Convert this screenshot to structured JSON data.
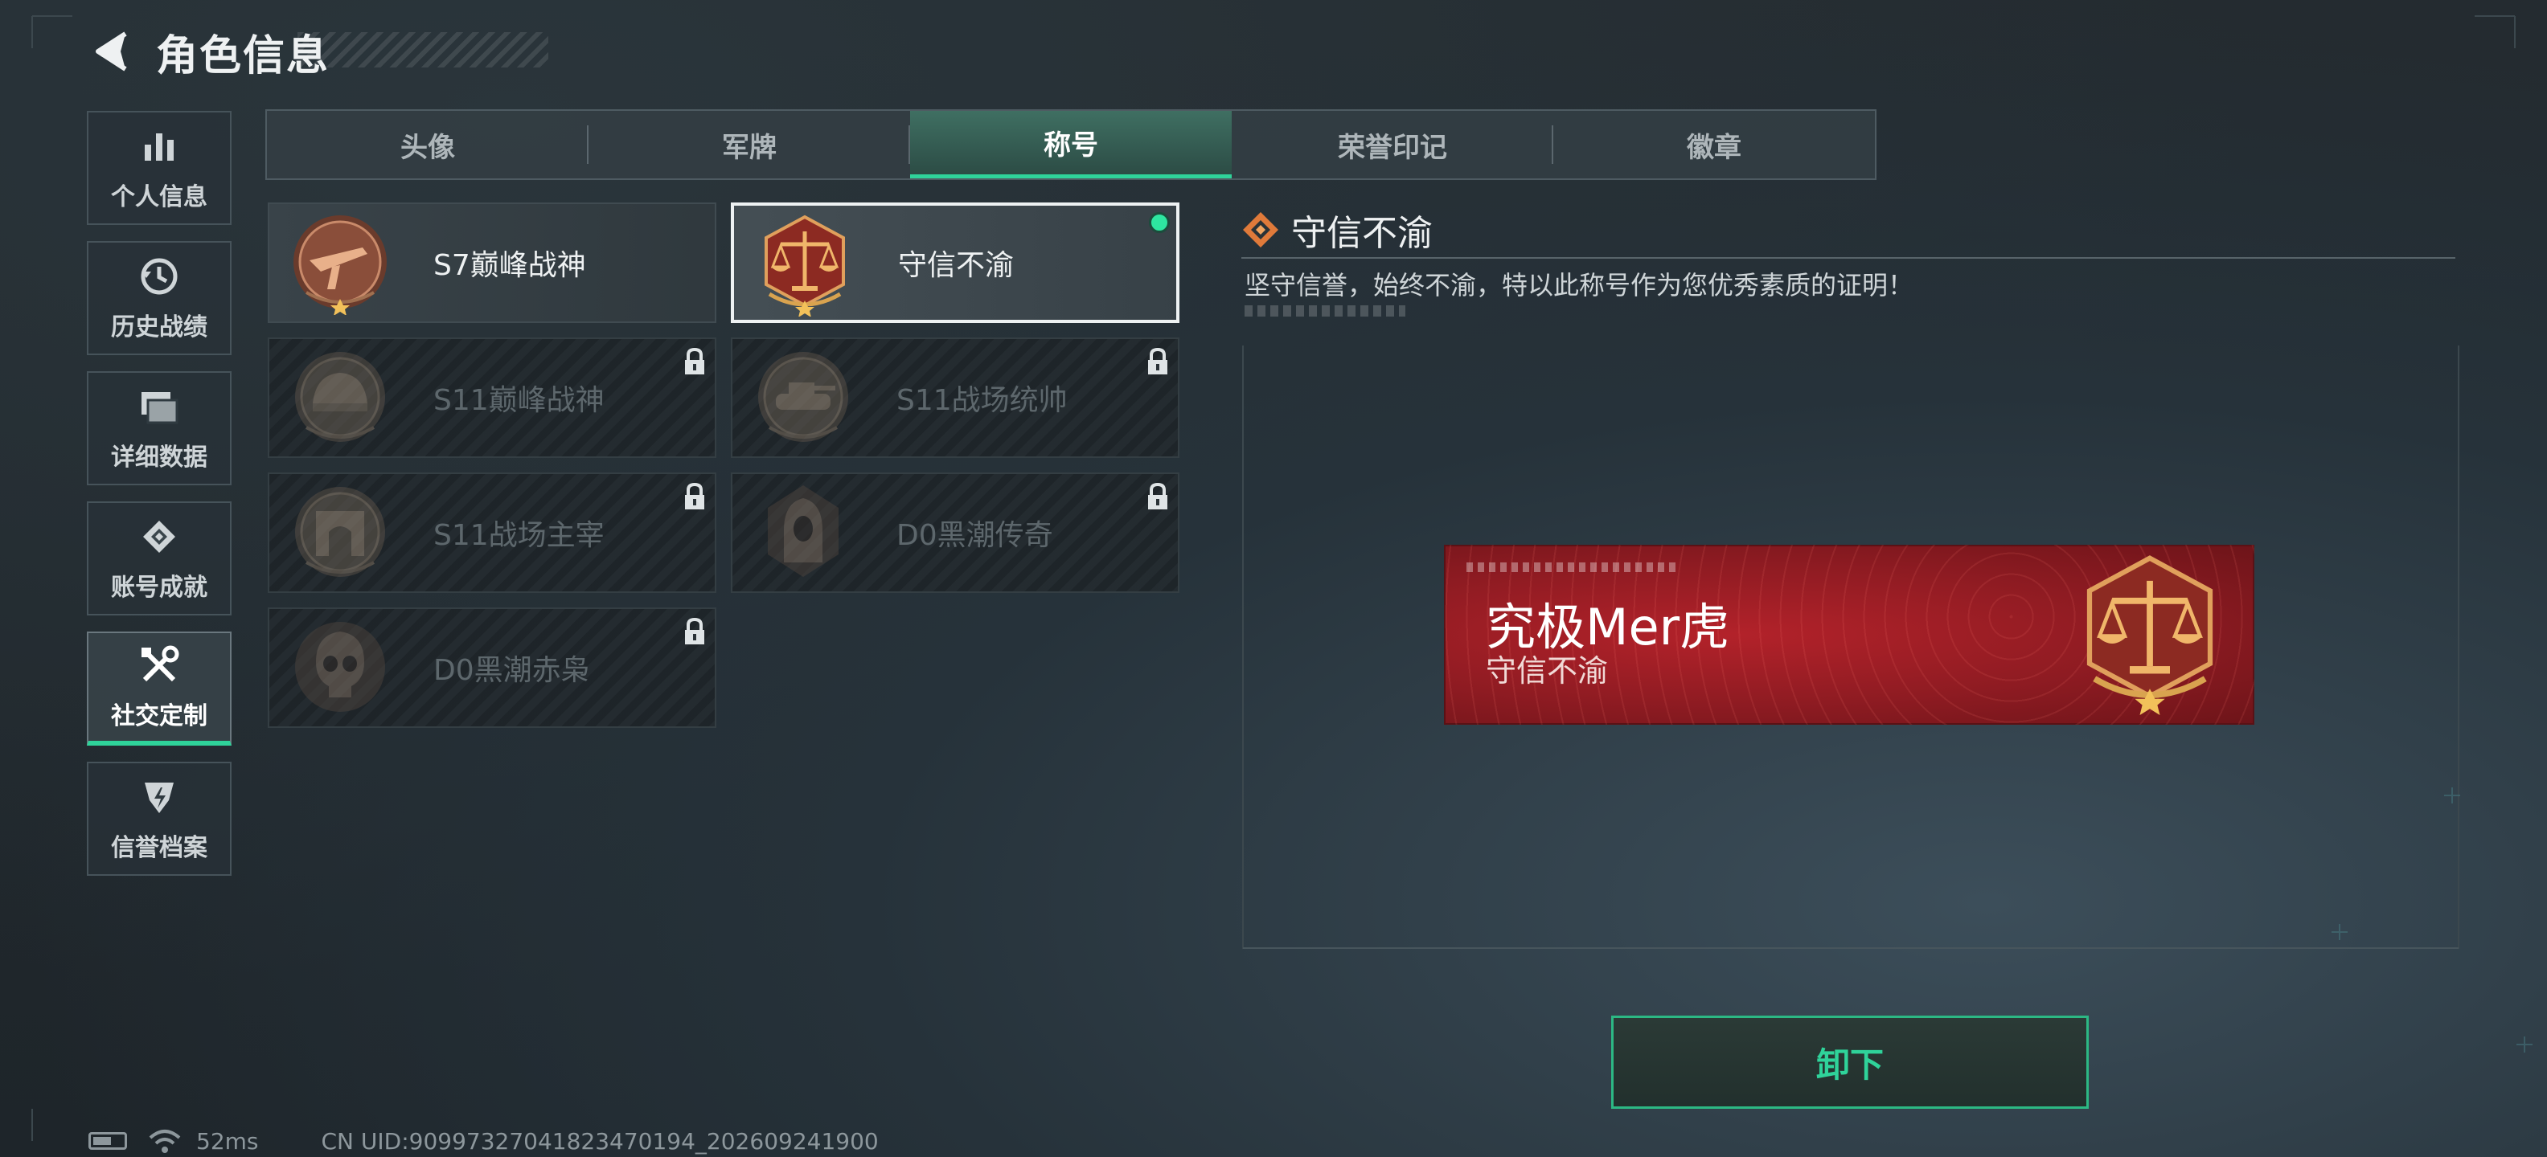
{
  "header": {
    "title": "角色信息"
  },
  "sidebar": {
    "items": [
      {
        "label": "个人信息",
        "icon": "bar-chart-icon"
      },
      {
        "label": "历史战绩",
        "icon": "history-clock-icon"
      },
      {
        "label": "详细数据",
        "icon": "folders-icon"
      },
      {
        "label": "账号成就",
        "icon": "achievement-icon"
      },
      {
        "label": "社交定制",
        "icon": "tools-icon",
        "active": true
      },
      {
        "label": "信誉档案",
        "icon": "credit-shield-icon"
      }
    ]
  },
  "tabs": [
    {
      "label": "头像"
    },
    {
      "label": "军牌"
    },
    {
      "label": "称号",
      "active": true
    },
    {
      "label": "荣誉印记"
    },
    {
      "label": "徽章"
    }
  ],
  "titles": [
    {
      "name": "S7巅峰战神",
      "medal": "rifle-medal-icon",
      "locked": false,
      "selected": false
    },
    {
      "name": "守信不渝",
      "medal": "scales-medal-icon",
      "locked": false,
      "selected": true
    },
    {
      "name": "S11巅峰战神",
      "medal": "helmet-medal-icon",
      "locked": true
    },
    {
      "name": "S11战场统帅",
      "medal": "tank-medal-icon",
      "locked": true
    },
    {
      "name": "S11战场主宰",
      "medal": "arch-medal-icon",
      "locked": true
    },
    {
      "name": "D0黑潮传奇",
      "medal": "hooded-figure-medal-icon",
      "locked": true
    },
    {
      "name": "D0黑潮赤枭",
      "medal": "skull-medal-icon",
      "locked": true
    }
  ],
  "detail": {
    "title": "守信不渝",
    "description": "坚守信誉，始终不渝，特以此称号作为您优秀素质的证明！"
  },
  "banner": {
    "player_name": "究极Mer虎",
    "title": "守信不渝",
    "color": "#a51f27"
  },
  "actions": {
    "unequip_label": "卸下"
  },
  "status": {
    "ping": "52ms",
    "uid": "CN UID:90997327041823470194_202609241900"
  },
  "colors": {
    "accent": "#2fd39a",
    "selected_dot": "#2ee6a0"
  }
}
